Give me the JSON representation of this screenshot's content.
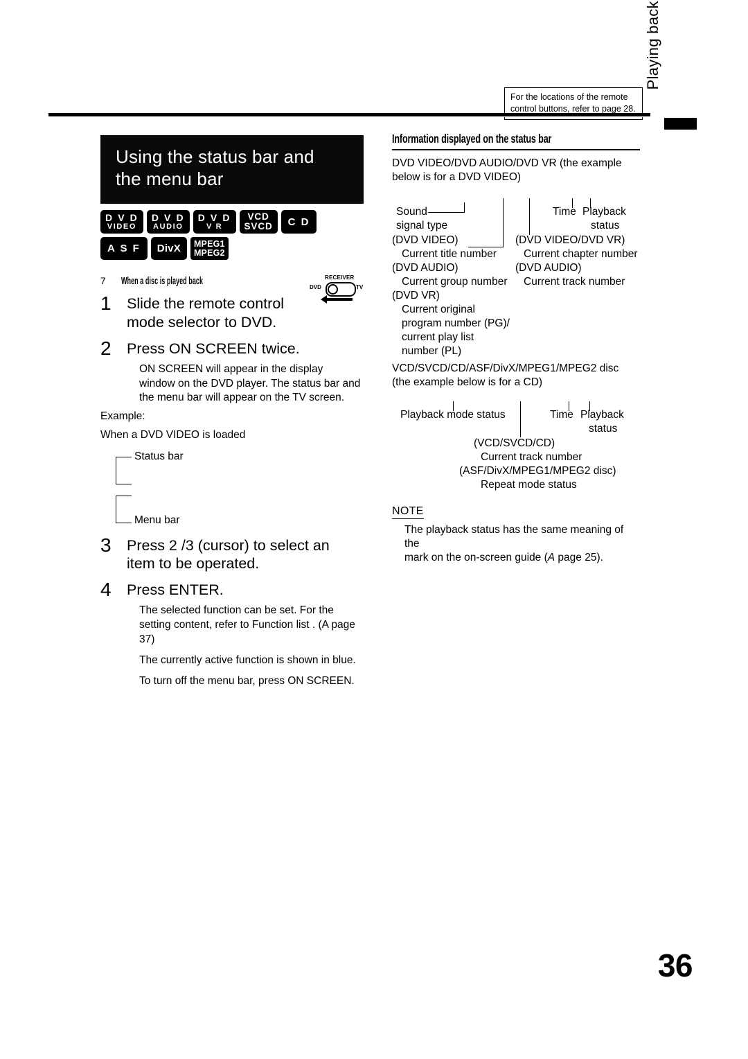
{
  "page": {
    "number": "36",
    "side_tab": "Playing back DVDs/CDs"
  },
  "remote_note": {
    "line1": "For the locations of the remote",
    "line2": "control buttons, refer to page 28."
  },
  "left": {
    "chapter_title_line1": "Using the status bar and",
    "chapter_title_line2": "the menu bar",
    "badges": [
      {
        "type": "two",
        "line1": "D V D",
        "line2": "VIDEO"
      },
      {
        "type": "two",
        "line1": "D V D",
        "line2": "AUDIO"
      },
      {
        "type": "two",
        "line1": "D V D",
        "line2": "V R"
      },
      {
        "type": "two-big",
        "line1": "VCD",
        "line2": "SVCD"
      },
      {
        "type": "single",
        "line1": "C D"
      },
      {
        "type": "single",
        "line1": "A S F"
      },
      {
        "type": "divx",
        "line1": "DivX"
      },
      {
        "type": "mpeg",
        "line1": "MPEG1",
        "line2": "MPEG2"
      }
    ],
    "subhead_marker": "7",
    "subhead": "When a disc is played back",
    "steps": [
      {
        "num": "1",
        "title_line1": "Slide the remote control",
        "title_line2": "mode selector to DVD."
      },
      {
        "num": "2",
        "title_line1": "Press ON SCREEN twice.",
        "body": "ON SCREEN  will appear in the display window on the DVD player. The status bar and the menu bar will appear on the TV screen."
      },
      {
        "num": "3",
        "title_line1": "Press 2 /3  (cursor) to select an",
        "title_line2": "item to be operated."
      },
      {
        "num": "4",
        "title_line1": "Press ENTER.",
        "body1": "The selected function can be set. For the setting content, refer to  Function list . (A  page 37)",
        "body2": "The currently active function is shown in blue.",
        "body3": "To turn off the menu bar, press ON SCREEN."
      }
    ],
    "example_label": "Example:",
    "example_text": "When a DVD VIDEO is loaded",
    "bracket_status_label": "Status bar",
    "bracket_menu_label": "Menu bar",
    "mode_selector": {
      "receiver": "RECEIVER",
      "left_label": "DVD",
      "right_label": "TV"
    }
  },
  "right": {
    "section_heading": "Information displayed on the status bar",
    "intro1_line1": "DVD VIDEO/DVD AUDIO/DVD VR (the example",
    "intro1_line2": "below is for a DVD VIDEO)",
    "diagram1": {
      "sound_label_line1": "Sound",
      "sound_label_line2": "signal type",
      "left_group_line1": "(DVD VIDEO)",
      "left_group_line2": "Current title number",
      "left_group_line3": "(DVD AUDIO)",
      "left_group_line4": "Current group number",
      "left_group_line5": "(DVD VR)",
      "left_group_line6": "Current original",
      "left_group_line7": "program number (PG)/",
      "left_group_line8": "current play list",
      "left_group_line9": "number (PL)",
      "time_label": "Time",
      "playback_label_line1": "Playback",
      "playback_label_line2": "status",
      "right_group_line1": "(DVD VIDEO/DVD VR)",
      "right_group_line2": "Current chapter number",
      "right_group_line3": "(DVD AUDIO)",
      "right_group_line4": "Current track number"
    },
    "intro2_line1": "VCD/SVCD/CD/ASF/DivX/MPEG1/MPEG2 disc",
    "intro2_line2": "(the example below is for a CD)",
    "diagram2": {
      "playback_mode_label": "Playback mode status",
      "time_label": "Time",
      "playback_label_line1": "Playback",
      "playback_label_line2": "status",
      "center_line1": "(VCD/SVCD/CD)",
      "center_line2": "Current track number",
      "center_line3": "(ASF/DivX/MPEG1/MPEG2 disc)",
      "center_line4": "Repeat mode status"
    },
    "note_title": "NOTE",
    "note_line1": "The playback status has the same meaning of the",
    "note_line2_pre": "mark on the on-screen guide (",
    "note_line2_italic": "A",
    "note_line2_post": "  page 25)."
  }
}
